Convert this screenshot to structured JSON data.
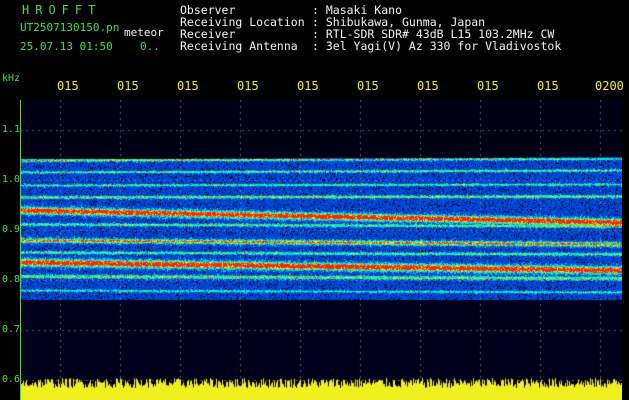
{
  "header": {
    "logo": "HROFFT",
    "filename": "UT2507130150.pn",
    "meteor_label": "meteor",
    "datetime": "25.07.13 01:50",
    "count": "0.."
  },
  "meta": [
    {
      "label": "Observer",
      "value": ": Masaki Kano"
    },
    {
      "label": "Receiving Location",
      "value": ": Shibukawa, Gunma, Japan"
    },
    {
      "label": "Receiver",
      "value": ": RTL-SDR SDR# 43dB L15 103.2MHz CW"
    },
    {
      "label": "Receiving Antenna",
      "value": ": 3el Yagi(V) Az 330 for Vladivostok"
    }
  ],
  "y_axis": {
    "unit": "kHz",
    "ticks": [
      "1.1",
      "1.0",
      "0.9",
      "0.8",
      "0.7",
      "0.6"
    ]
  },
  "time_axis": {
    "ticks": [
      "015",
      "015",
      "015",
      "015",
      "015",
      "015",
      "015",
      "015",
      "015",
      "0200"
    ]
  },
  "colors": {
    "axis_green": "#3fe23f",
    "time_yellow": "#f0f020",
    "noise_yellow": "#f0f020",
    "background_blue": "#0a1a7a"
  }
}
